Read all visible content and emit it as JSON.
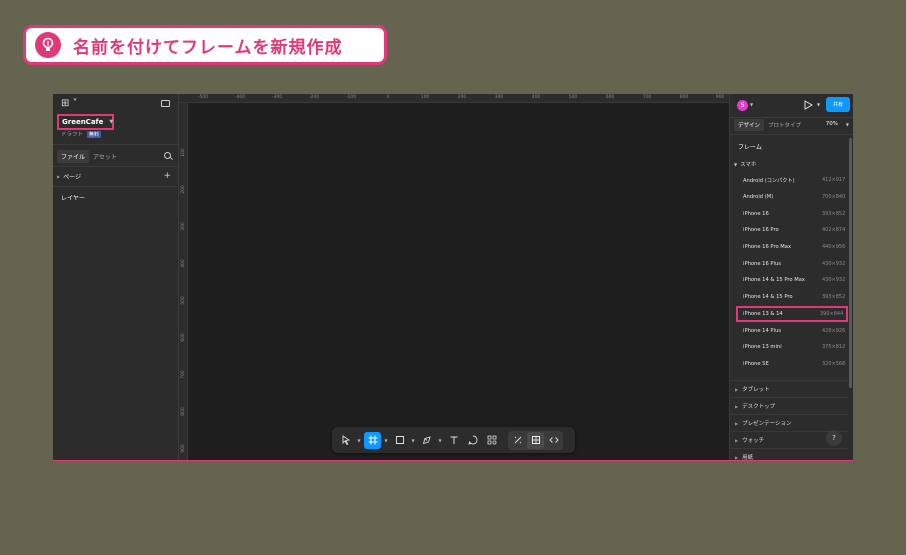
{
  "banner": {
    "title": "名前を付けてフレームを新規作成"
  },
  "left_panel": {
    "file_name": "GreenCafe",
    "draft_label": "ドラフト",
    "free_badge": "無料",
    "tabs": [
      "ファイル",
      "アセット"
    ],
    "pages_label": "ページ",
    "layers_label": "レイヤー"
  },
  "ruler": {
    "h_ticks": [
      "-500",
      "-400",
      "-300",
      "-200",
      "-100",
      "0",
      "100",
      "200",
      "300",
      "400",
      "500",
      "600",
      "700",
      "800",
      "900"
    ],
    "v_ticks": [
      "100",
      "200",
      "300",
      "400",
      "500",
      "600",
      "700",
      "800",
      "900"
    ]
  },
  "right_panel": {
    "avatar_letter": "S",
    "share_label": "共有",
    "tabs": [
      "デザイン",
      "プロトタイプ"
    ],
    "zoom": "70%",
    "frame_label": "フレーム",
    "smartphone_label": "スマホ",
    "devices": [
      {
        "name": "Android (コンパクト)",
        "size": "412×917"
      },
      {
        "name": "Android (M)",
        "size": "700×840"
      },
      {
        "name": "iPhone 16",
        "size": "393×852"
      },
      {
        "name": "iPhone 16 Pro",
        "size": "402×874"
      },
      {
        "name": "iPhone 16 Pro Max",
        "size": "440×956"
      },
      {
        "name": "iPhone 16 Plus",
        "size": "430×932"
      },
      {
        "name": "iPhone 14 & 15 Pro Max",
        "size": "430×932"
      },
      {
        "name": "iPhone 14 & 15 Pro",
        "size": "393×852"
      },
      {
        "name": "iPhone 13 & 14",
        "size": "390×844",
        "highlighted": true
      },
      {
        "name": "iPhone 14 Plus",
        "size": "428×926"
      },
      {
        "name": "iPhone 13 mini",
        "size": "375×812"
      },
      {
        "name": "iPhone SE",
        "size": "320×568"
      }
    ],
    "categories": [
      "タブレット",
      "デスクトップ",
      "プレゼンテーション",
      "ウォッチ",
      "用紙"
    ],
    "help_label": "?"
  },
  "colors": {
    "accent_pink": "#e0397a",
    "figma_blue": "#0d99ff",
    "app_bg": "#1e1e1e",
    "panel_bg": "#2c2c2c",
    "outer_bg": "#64644f"
  }
}
